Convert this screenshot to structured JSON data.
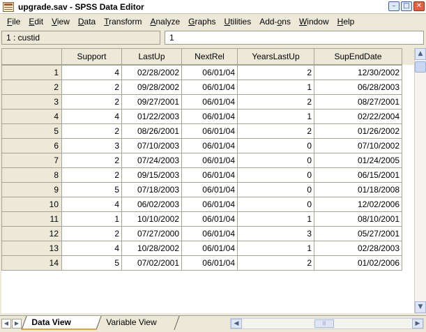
{
  "window": {
    "title": "upgrade.sav - SPSS Data Editor",
    "minimize": "–",
    "maximize": "□",
    "close": "✕"
  },
  "menu": [
    {
      "u": "F",
      "rest": "ile"
    },
    {
      "u": "E",
      "rest": "dit"
    },
    {
      "u": "V",
      "rest": "iew"
    },
    {
      "u": "D",
      "rest": "ata"
    },
    {
      "u": "T",
      "rest": "ransform"
    },
    {
      "u": "A",
      "rest": "nalyze"
    },
    {
      "u": "G",
      "rest": "raphs"
    },
    {
      "u": "U",
      "rest": "tilities"
    },
    {
      "pre": "Add-",
      "u": "o",
      "rest": "ns"
    },
    {
      "u": "W",
      "rest": "indow"
    },
    {
      "u": "H",
      "rest": "elp"
    }
  ],
  "cellbar": {
    "reference": "1 : custid",
    "value": "1"
  },
  "grid": {
    "columns": [
      "",
      "Support",
      "LastUp",
      "NextRel",
      "YearsLastUp",
      "SupEndDate"
    ],
    "rows": [
      [
        "1",
        "4",
        "02/28/2002",
        "06/01/04",
        "2",
        "12/30/2002"
      ],
      [
        "2",
        "2",
        "09/28/2002",
        "06/01/04",
        "1",
        "06/28/2003"
      ],
      [
        "3",
        "2",
        "09/27/2001",
        "06/01/04",
        "2",
        "08/27/2001"
      ],
      [
        "4",
        "4",
        "01/22/2003",
        "06/01/04",
        "1",
        "02/22/2004"
      ],
      [
        "5",
        "2",
        "08/26/2001",
        "06/01/04",
        "2",
        "01/26/2002"
      ],
      [
        "6",
        "3",
        "07/10/2003",
        "06/01/04",
        "0",
        "07/10/2002"
      ],
      [
        "7",
        "2",
        "07/24/2003",
        "06/01/04",
        "0",
        "01/24/2005"
      ],
      [
        "8",
        "2",
        "09/15/2003",
        "06/01/04",
        "0",
        "06/15/2001"
      ],
      [
        "9",
        "5",
        "07/18/2003",
        "06/01/04",
        "0",
        "01/18/2008"
      ],
      [
        "10",
        "4",
        "06/02/2003",
        "06/01/04",
        "0",
        "12/02/2006"
      ],
      [
        "11",
        "1",
        "10/10/2002",
        "06/01/04",
        "1",
        "08/10/2001"
      ],
      [
        "12",
        "2",
        "07/27/2000",
        "06/01/04",
        "3",
        "05/27/2001"
      ],
      [
        "13",
        "4",
        "10/28/2002",
        "06/01/04",
        "1",
        "02/28/2003"
      ],
      [
        "14",
        "5",
        "07/02/2001",
        "06/01/04",
        "2",
        "01/02/2006"
      ]
    ]
  },
  "tabs": {
    "data_view": "Data View",
    "variable_view": "Variable View"
  },
  "icons": {
    "scroll_up": "▲",
    "scroll_down": "▼",
    "scroll_left": "◀",
    "scroll_right": "▶",
    "tab_prev": "◀",
    "tab_next": "▶",
    "thumb_grip": "|||"
  }
}
